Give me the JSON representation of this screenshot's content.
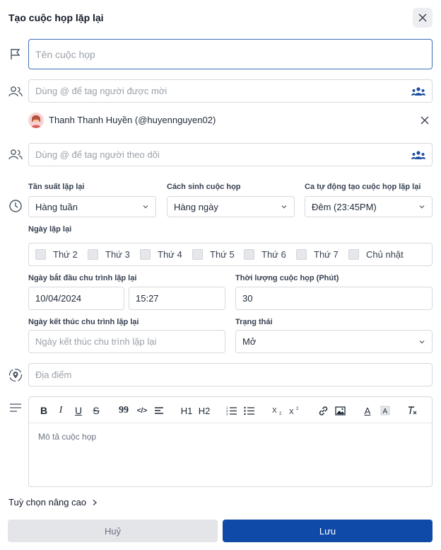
{
  "dialog": {
    "title": "Tạo cuộc họp lặp lại"
  },
  "meeting_name": {
    "placeholder": "Tên cuộc họp"
  },
  "invitees": {
    "placeholder": "Dùng @ để tag người được mời"
  },
  "invited_person": {
    "name": "Thanh Thanh Huyền (@huyennguyen02)"
  },
  "followers": {
    "placeholder": "Dùng @ để tag người theo dõi"
  },
  "frequency": {
    "label": "Tần suất lặp lại",
    "value": "Hàng tuần"
  },
  "generation": {
    "label": "Cách sinh cuộc họp",
    "value": "Hàng ngày"
  },
  "auto_shift": {
    "label": "Ca tự động tạo cuộc họp lặp lại",
    "value": "Đêm (23:45PM)"
  },
  "repeat_days": {
    "label": "Ngày lặp lại",
    "days": [
      "Thứ 2",
      "Thứ 3",
      "Thứ 4",
      "Thứ 5",
      "Thứ 6",
      "Thứ 7",
      "Chủ nhật"
    ]
  },
  "start": {
    "label": "Ngày bắt đầu chu trình lặp lại",
    "date": "10/04/2024",
    "time": "15:27"
  },
  "duration": {
    "label": "Thời lượng cuộc họp (Phút)",
    "value": "30"
  },
  "end": {
    "label": "Ngày kết thúc chu trình lặp lại",
    "placeholder": "Ngày kết thúc chu trình lặp lại"
  },
  "status": {
    "label": "Trạng thái",
    "value": "Mở"
  },
  "location": {
    "placeholder": "Địa điểm"
  },
  "editor": {
    "placeholder": "Mô tả cuộc họp",
    "tools": {
      "bold": "B",
      "italic": "I",
      "underline": "U",
      "strike": "S",
      "quote": "99",
      "code": "</>",
      "h1": "H1",
      "h2": "H2",
      "sub": "X2",
      "sup": "X2",
      "text_color": "A"
    }
  },
  "advanced": {
    "label": "Tuỳ chọn nâng cao"
  },
  "actions": {
    "cancel": "Huỷ",
    "save": "Lưu"
  },
  "colors": {
    "primary": "#0f4aa8",
    "secondary_btn": "#e5e7eb",
    "focus_border": "#3b6fb6"
  }
}
